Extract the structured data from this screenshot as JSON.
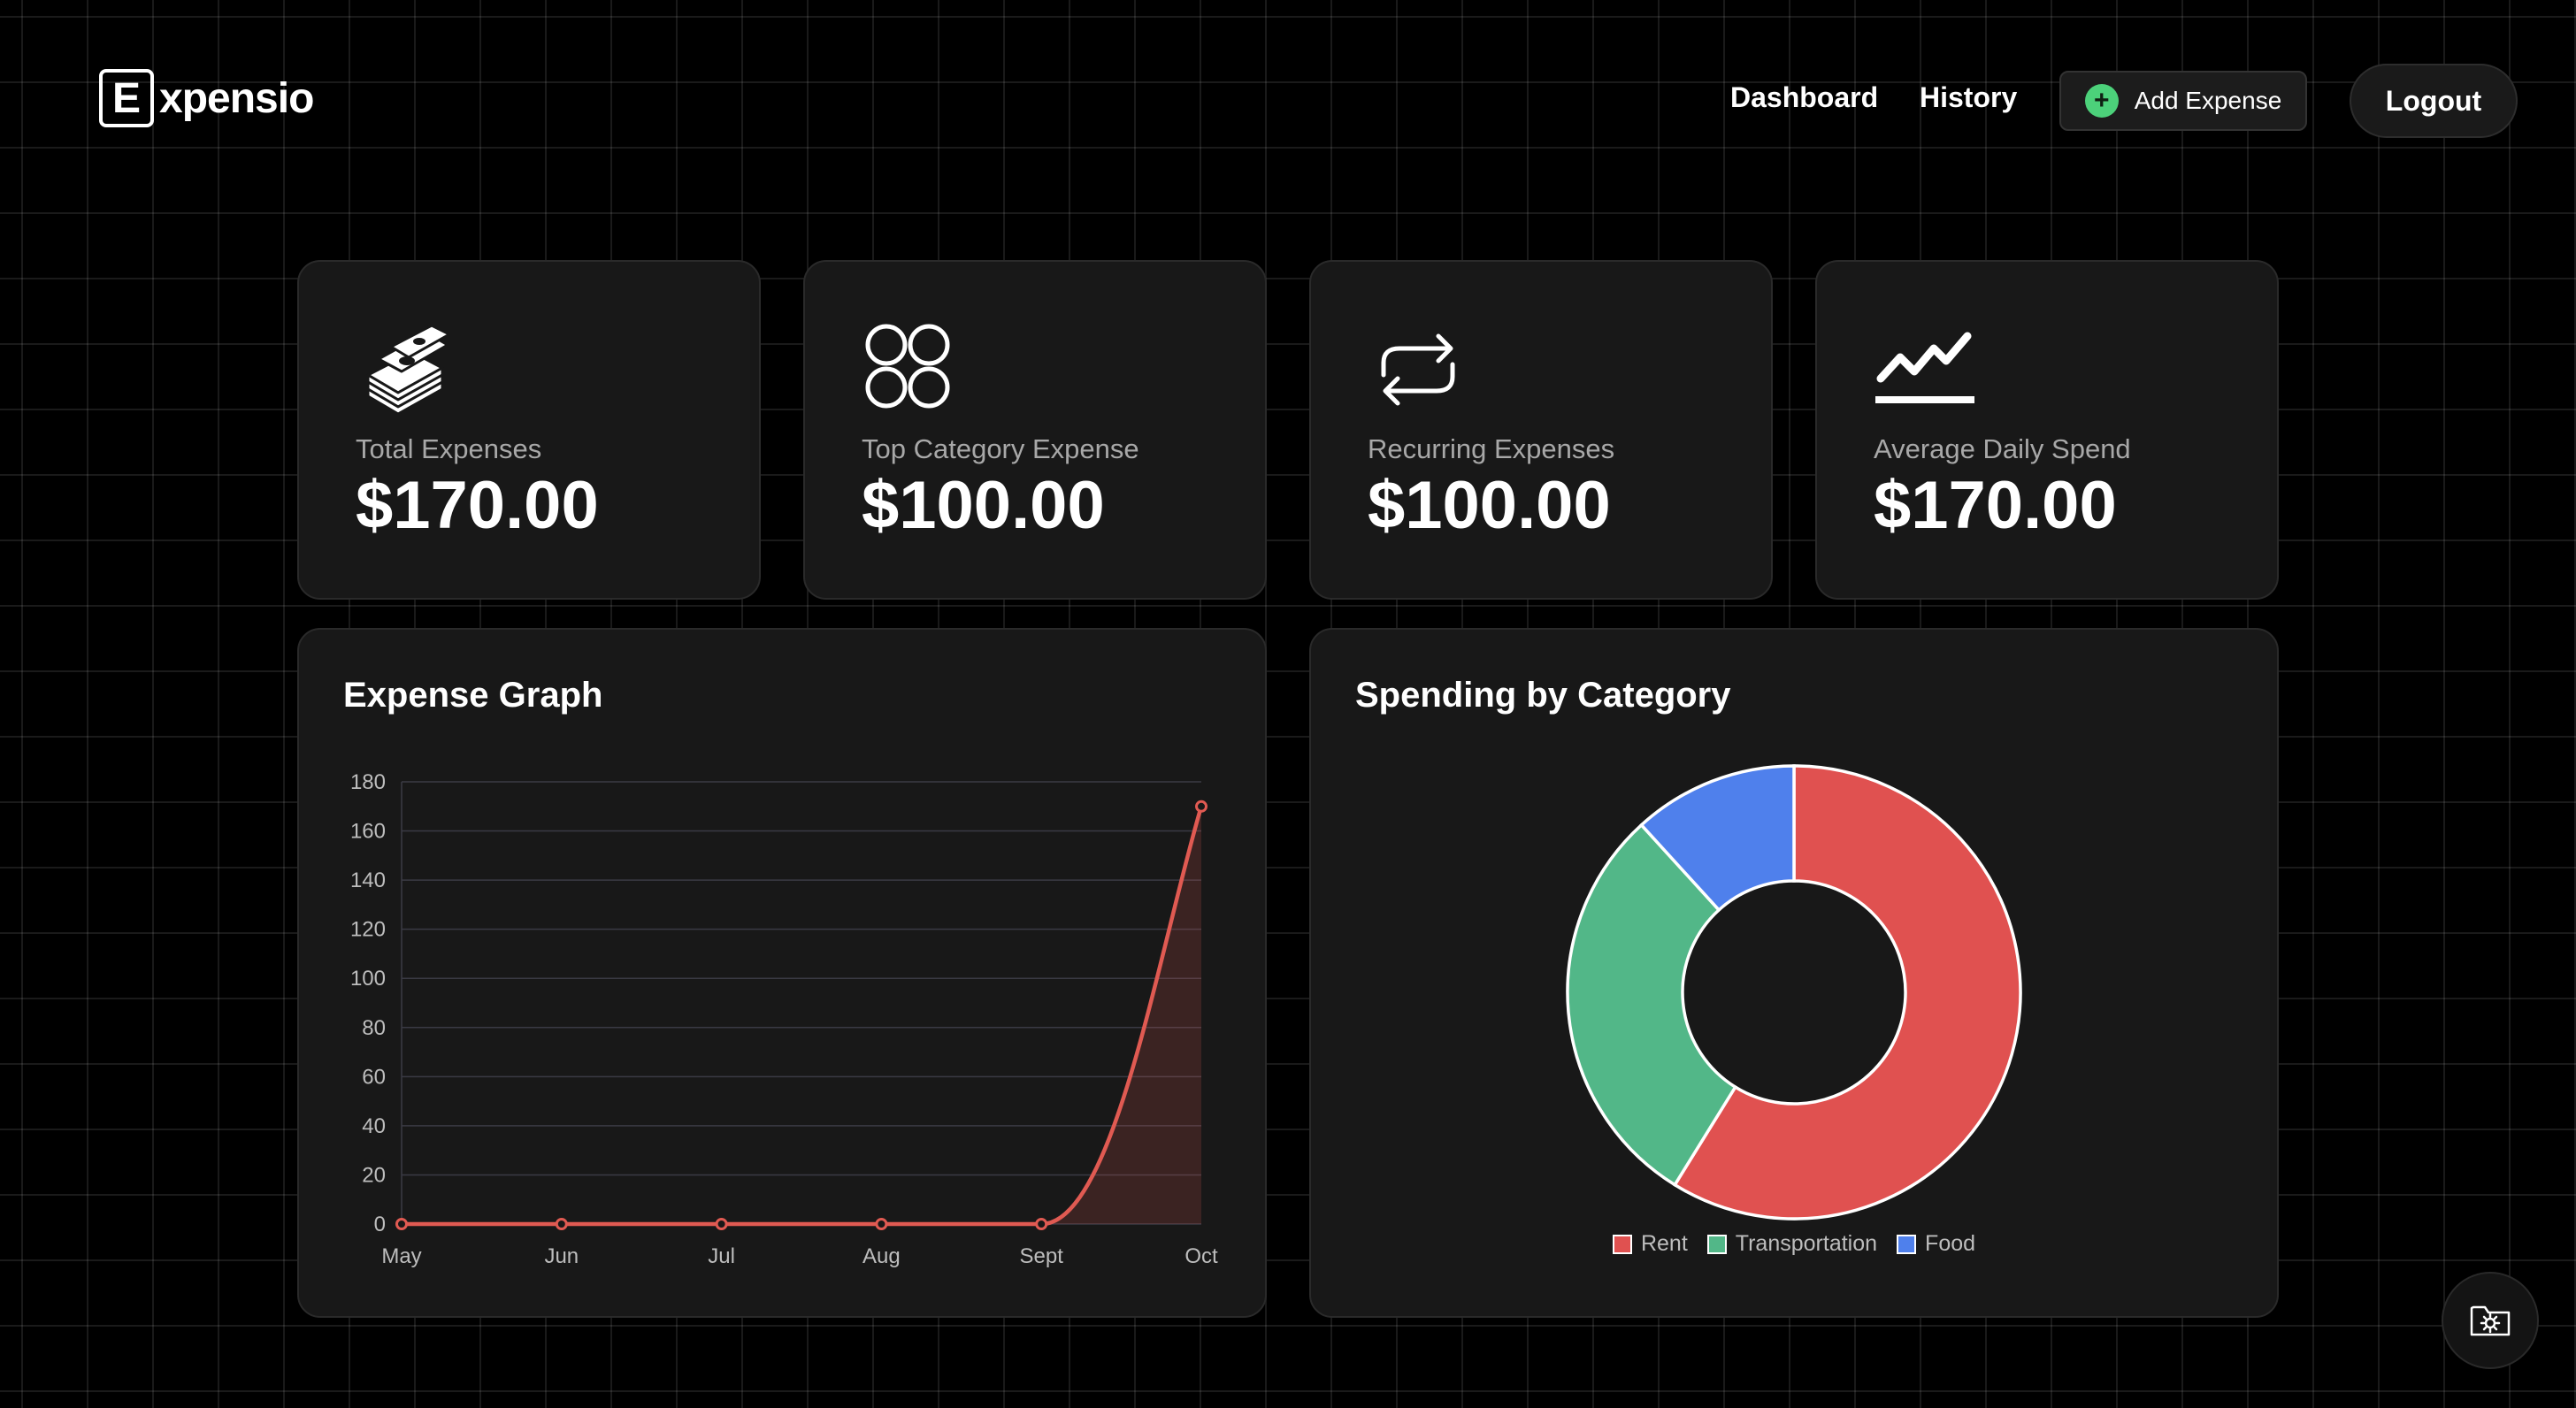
{
  "brand": {
    "mark": "E",
    "name": "xpensio"
  },
  "nav": {
    "dashboard": "Dashboard",
    "history": "History",
    "add_expense": "Add Expense",
    "logout": "Logout"
  },
  "stats": [
    {
      "icon": "money-stack-icon",
      "label": "Total Expenses",
      "value": "$170.00"
    },
    {
      "icon": "category-grid-icon",
      "label": "Top Category Expense",
      "value": "$100.00"
    },
    {
      "icon": "repeat-icon",
      "label": "Recurring Expenses",
      "value": "$100.00"
    },
    {
      "icon": "trend-line-icon",
      "label": "Average Daily Spend",
      "value": "$170.00"
    }
  ],
  "charts": {
    "expense_title": "Expense Graph",
    "category_title": "Spending by Category"
  },
  "colors": {
    "line": "#e05a52",
    "rent": "#e05150",
    "transportation": "#52b788",
    "food": "#4f80ec",
    "accent_green": "#4cd17a"
  },
  "chart_data": [
    {
      "type": "line",
      "title": "Expense Graph",
      "x": [
        "May",
        "Jun",
        "Jul",
        "Aug",
        "Sept",
        "Oct"
      ],
      "series": [
        {
          "values": [
            0,
            0,
            0,
            0,
            0,
            170
          ]
        }
      ],
      "ylim": [
        0,
        180
      ],
      "yticks": [
        0,
        20,
        40,
        60,
        80,
        100,
        120,
        140,
        160,
        180
      ],
      "grid": true,
      "fill": true
    },
    {
      "type": "pie",
      "variant": "doughnut",
      "title": "Spending by Category",
      "categories": [
        "Rent",
        "Transportation",
        "Food"
      ],
      "values": [
        100,
        50,
        20
      ],
      "legend": "bottom"
    }
  ],
  "fab": {
    "icon": "folder-settings-icon"
  }
}
